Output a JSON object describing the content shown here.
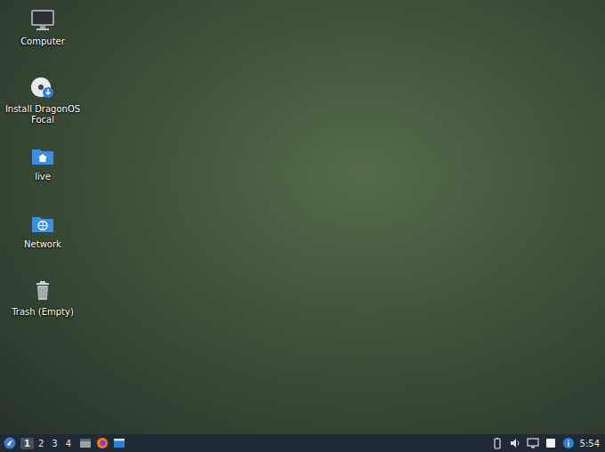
{
  "desktop": {
    "icons": [
      {
        "label": "Computer",
        "kind": "computer"
      },
      {
        "label": "Install DragonOS Focal",
        "kind": "installer"
      },
      {
        "label": "live",
        "kind": "home"
      },
      {
        "label": "Network",
        "kind": "network"
      },
      {
        "label": "Trash (Empty)",
        "kind": "trash"
      }
    ]
  },
  "taskbar": {
    "workspaces": [
      {
        "label": "1",
        "selected": true
      },
      {
        "label": "2",
        "selected": false
      },
      {
        "label": "3",
        "selected": false
      },
      {
        "label": "4",
        "selected": false
      }
    ],
    "clock": "5:54"
  }
}
